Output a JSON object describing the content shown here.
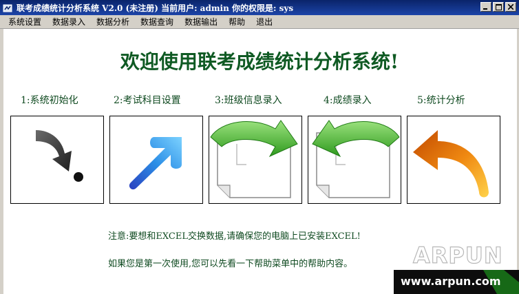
{
  "window": {
    "title": "联考成绩统计分析系统 V2.0 (未注册)  当前用户: admin  你的权限是: sys",
    "buttons": {
      "minimize": "_",
      "maximize": "□",
      "close": "×"
    }
  },
  "menu": {
    "items": [
      "系统设置",
      "数据录入",
      "数据分析",
      "数据查询",
      "数据输出",
      "帮助",
      "退出"
    ]
  },
  "main": {
    "welcome": "欢迎使用联考成绩统计分析系统!",
    "steps": [
      {
        "label": "1:系统初始化"
      },
      {
        "label": "2:考试科目设置"
      },
      {
        "label": "3:班级信息录入"
      },
      {
        "label": "4:成绩录入"
      },
      {
        "label": "5:统计分析"
      }
    ],
    "note1": "注意:要想和EXCEL交换数据,请确保您的电脑上已安装EXCEL!",
    "note2": "如果您是第一次使用,您可以先看一下帮助菜单中的帮助内容。"
  },
  "watermark": {
    "logo": "ARPUN",
    "url": "www.arpun.com"
  },
  "colors": {
    "title_bar": "#0a246a",
    "heading_green": "#0f5a23",
    "menu_bg": "#d4d0c8"
  }
}
